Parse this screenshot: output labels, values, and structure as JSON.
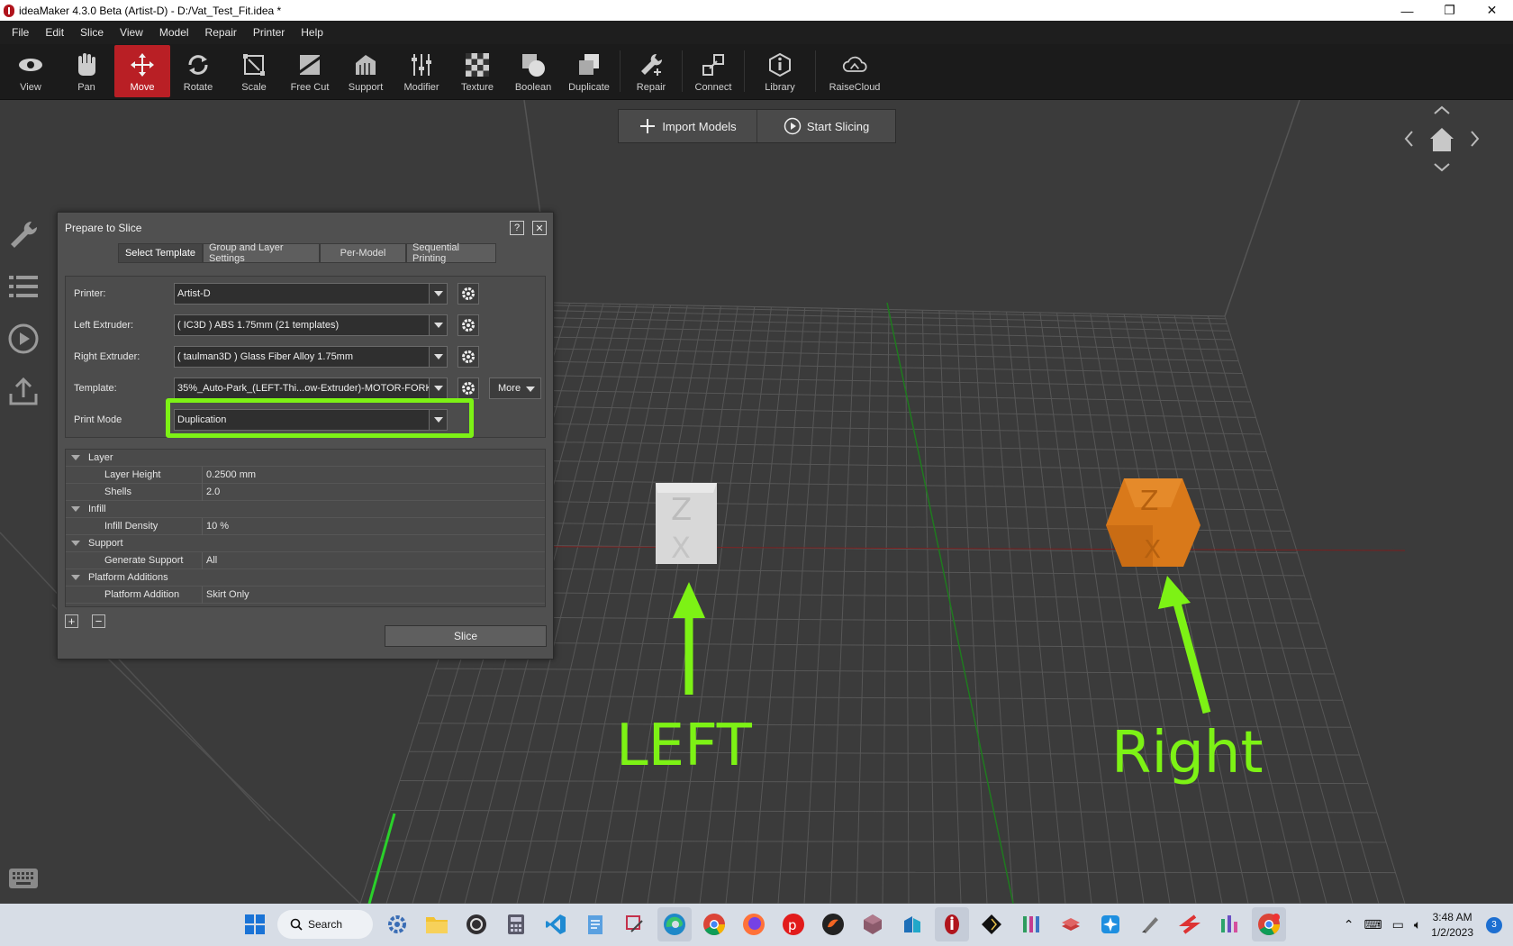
{
  "titlebar": {
    "title": "ideaMaker 4.3.0 Beta (Artist-D) - D:/Vat_Test_Fit.idea *",
    "min": "—",
    "max": "❐",
    "close": "✕"
  },
  "menu": [
    "File",
    "Edit",
    "Slice",
    "View",
    "Model",
    "Repair",
    "Printer",
    "Help"
  ],
  "toolbar": [
    {
      "label": "View",
      "icon": "eye-icon"
    },
    {
      "label": "Pan",
      "icon": "hand-icon"
    },
    {
      "label": "Move",
      "icon": "move-icon",
      "active": true
    },
    {
      "label": "Rotate",
      "icon": "rotate-icon"
    },
    {
      "label": "Scale",
      "icon": "scale-icon"
    },
    {
      "label": "Free Cut",
      "icon": "free-cut-icon"
    },
    {
      "label": "Support",
      "icon": "support-icon"
    },
    {
      "label": "Modifier",
      "icon": "modifier-icon"
    },
    {
      "label": "Texture",
      "icon": "texture-icon"
    },
    {
      "label": "Boolean",
      "icon": "boolean-icon"
    },
    {
      "label": "Duplicate",
      "icon": "duplicate-icon"
    },
    {
      "label": "Repair",
      "icon": "repair-icon"
    },
    {
      "label": "Connect",
      "icon": "connect-icon"
    },
    {
      "label": "Library",
      "icon": "library-icon"
    },
    {
      "label": "RaiseCloud",
      "icon": "cloud-icon"
    }
  ],
  "center_bar": {
    "import": "Import Models",
    "slice": "Start Slicing"
  },
  "dialog": {
    "title": "Prepare to Slice",
    "help": "?",
    "close": "✕",
    "tabs": [
      "Select Template",
      "Group and Layer Settings",
      "Per-Model",
      "Sequential Printing"
    ],
    "printer_label": "Printer:",
    "printer_value": "Artist-D",
    "left_extruder_label": "Left Extruder:",
    "left_extruder_value": "( IC3D ) ABS 1.75mm (21 templates)",
    "right_extruder_label": "Right Extruder:",
    "right_extruder_value": "( taulman3D ) Glass Fiber Alloy 1.75mm",
    "template_label": "Template:",
    "template_value": "35%_Auto-Park_(LEFT-Thi...ow-Extruder)-MOTOR-FORK",
    "more": "More",
    "print_mode_label": "Print Mode",
    "print_mode_value": "Duplication",
    "settings": [
      {
        "group": "Layer",
        "items": [
          {
            "key": "Layer Height",
            "value": "0.2500 mm"
          },
          {
            "key": "Shells",
            "value": "2.0"
          }
        ]
      },
      {
        "group": "Infill",
        "items": [
          {
            "key": "Infill Density",
            "value": "10 %"
          }
        ]
      },
      {
        "group": "Support",
        "items": [
          {
            "key": "Generate Support",
            "value": "All"
          }
        ]
      },
      {
        "group": "Platform Additions",
        "items": [
          {
            "key": "Platform Addition",
            "value": "Skirt Only"
          }
        ]
      }
    ],
    "add": "+",
    "remove": "−",
    "slice": "Slice"
  },
  "annotations": {
    "left": "LEFT",
    "right": "Right",
    "color": "#7df215"
  },
  "colors": {
    "accent": "#b91f25",
    "highlight": "#7df215",
    "right_cube": "#d9791a",
    "left_cube": "#d8d8d8"
  },
  "taskbar": {
    "search": "Search",
    "time": "3:48 AM",
    "date": "1/2/2023",
    "notifications": "3"
  }
}
